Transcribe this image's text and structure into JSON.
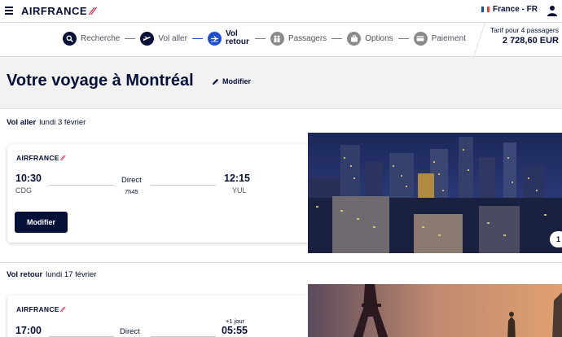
{
  "header": {
    "brand": "AIRFRANCE",
    "locale": "France - FR"
  },
  "stepper": {
    "steps": [
      {
        "label": "Recherche",
        "state": "done",
        "icon": "search-icon"
      },
      {
        "label": "Vol aller",
        "state": "done",
        "icon": "plane-takeoff-icon"
      },
      {
        "label": "Vol retour",
        "state": "active",
        "icon": "plane-return-icon"
      },
      {
        "label": "Passagers",
        "state": "todo",
        "icon": "passengers-icon"
      },
      {
        "label": "Options",
        "state": "todo",
        "icon": "suitcase-icon"
      },
      {
        "label": "Paiement",
        "state": "todo",
        "icon": "payment-icon"
      }
    ],
    "fare_label": "Tarif pour 4 passagers",
    "fare_amount": "2 728,60 EUR"
  },
  "page": {
    "title": "Votre voyage à Montréal",
    "modify_label": "Modifier"
  },
  "outbound": {
    "heading": "Vol aller",
    "date": "lundi 3 février",
    "brand": "AIRFRANCE",
    "departure_time": "10:30",
    "departure_code": "CDG",
    "direct_label": "Direct",
    "duration": "7h45",
    "arrival_time": "12:15",
    "arrival_code": "YUL",
    "modify_button": "Modifier",
    "carousel_index": "1"
  },
  "return": {
    "heading": "Vol retour",
    "date": "lundi 17 février",
    "brand": "AIRFRANCE",
    "departure_time": "17:00",
    "direct_label": "Direct",
    "day_offset": "+1 jour",
    "arrival_time": "05:55"
  },
  "colors": {
    "navy": "#051039",
    "brand_red": "#e4002b",
    "active_blue": "#1c4fd6"
  }
}
